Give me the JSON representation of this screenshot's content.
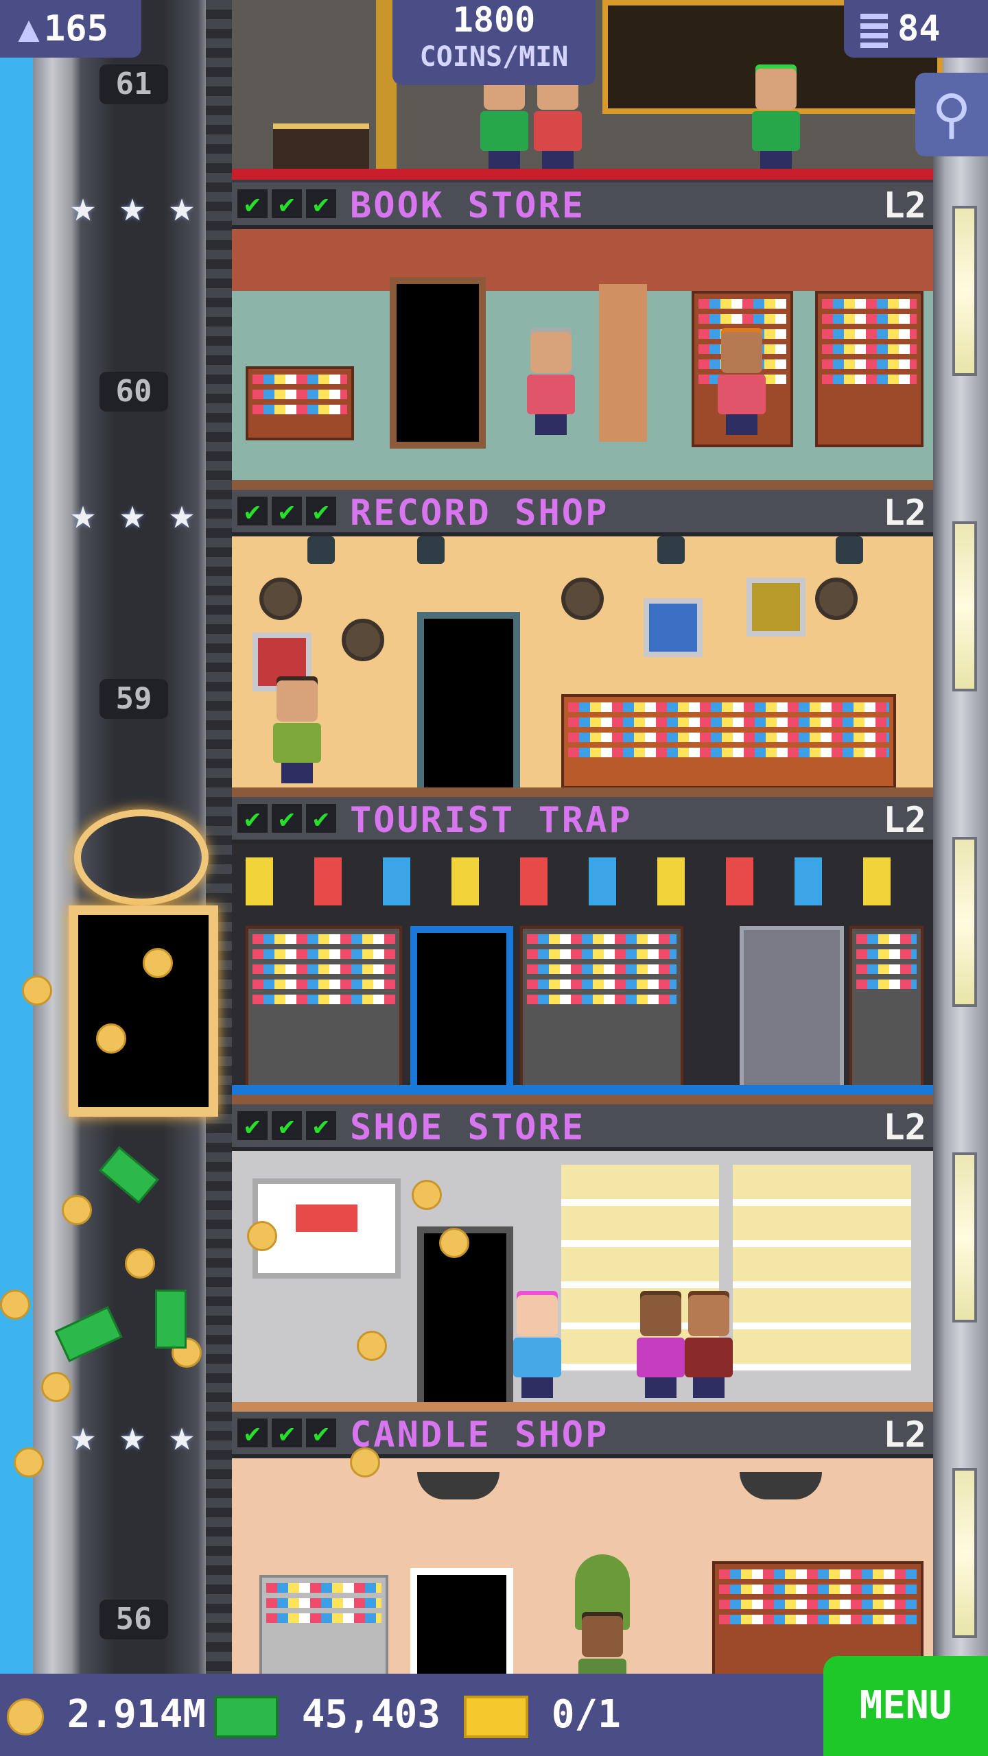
{
  "hud": {
    "population": "165",
    "coins_rate_value": "1800",
    "coins_rate_unit": "COINS/MIN",
    "floor_count": "84",
    "coins_total": "2.914M",
    "bux_total": "45,403",
    "vip_count": "0/1",
    "menu_label": "MENU"
  },
  "icons": {
    "population": "person-icon",
    "floors": "building-icon",
    "search": "magnifier-icon",
    "coins": "coin-icon",
    "bux": "banknote-icon",
    "vip": "vip-ticket-icon"
  },
  "elevator": {
    "floor_numbers": [
      "61",
      "60",
      "59",
      "56"
    ]
  },
  "floors": [
    {
      "name": "BOOK STORE",
      "level": "L2",
      "checks": "✔✔✔"
    },
    {
      "name": "RECORD SHOP",
      "level": "L2",
      "checks": "✔✔✔"
    },
    {
      "name": "TOURIST TRAP",
      "level": "L2",
      "checks": "✔✔✔"
    },
    {
      "name": "SHOE STORE",
      "level": "L2",
      "checks": "✔✔✔"
    },
    {
      "name": "CANDLE SHOP",
      "level": "L2",
      "checks": "✔✔✔"
    }
  ],
  "colors": {
    "hud_bg": "#4b4e86",
    "floor_name": "#d776ef",
    "check_green": "#27e02c",
    "menu_green": "#1ec828"
  }
}
